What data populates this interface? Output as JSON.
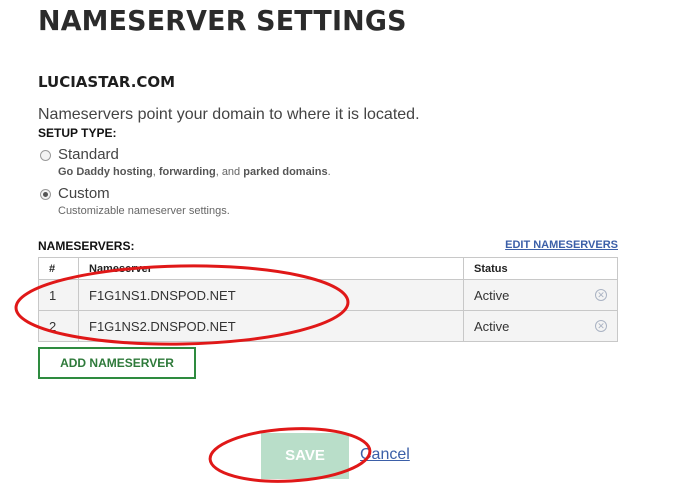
{
  "page": {
    "title": "NAMESERVER SETTINGS"
  },
  "domain": {
    "name": "LUCIASTAR.COM"
  },
  "description": "Nameservers point your domain to where it is located.",
  "setup_type": {
    "label": "SETUP TYPE:",
    "selected": "custom",
    "options": {
      "standard": {
        "label": "Standard",
        "help_parts": [
          "Go Daddy hosting",
          ", ",
          "forwarding",
          ", and ",
          "parked domains",
          "."
        ]
      },
      "custom": {
        "label": "Custom",
        "help": "Customizable nameserver settings."
      }
    }
  },
  "nameservers": {
    "label": "NAMESERVERS:",
    "edit_link": "EDIT NAMESERVERS",
    "columns": [
      "#",
      "Nameserver",
      "Status"
    ],
    "rows": [
      {
        "num": "1",
        "name": "F1G1NS1.DNSPOD.NET",
        "status": "Active",
        "remove_icon": "circle-x-icon"
      },
      {
        "num": "2",
        "name": "F1G1NS2.DNSPOD.NET",
        "status": "Active",
        "remove_icon": "circle-x-icon"
      }
    ]
  },
  "actions": {
    "add": "ADD NAMESERVER",
    "save": "SAVE",
    "cancel": "Cancel"
  },
  "colors": {
    "title": "#2b2b2b",
    "link": "#3b5fa8",
    "add_border": "#2e8b3f",
    "save_disabled_bg": "#b9dec9",
    "annotation": "#e01818"
  }
}
